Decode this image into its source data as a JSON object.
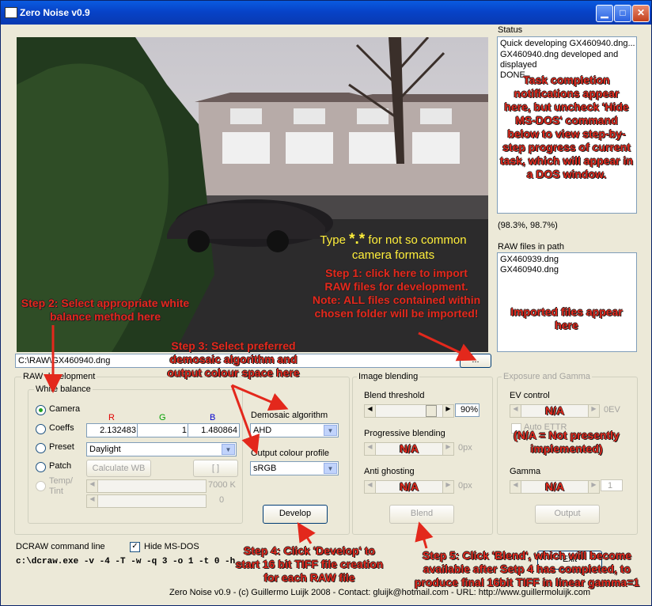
{
  "window": {
    "title": "Zero Noise v0.9"
  },
  "status": {
    "label": "Status",
    "lines": [
      "Quick developing GX460940.dng...",
      "GX460940.dng developed and",
      "displayed",
      "DONE"
    ],
    "coords": "(98.3%, 98.7%)"
  },
  "raw_files": {
    "label": "RAW files in path",
    "items": [
      "GX460939.dng",
      "GX460940.dng"
    ]
  },
  "path_field": {
    "value": "C:\\RAW\\GX460940.dng",
    "browse_label": "..."
  },
  "raw_dev": {
    "title": "RAW development",
    "wb_title": "White balance",
    "camera": "Camera",
    "coeffs": "Coeffs",
    "preset": "Preset",
    "patch": "Patch",
    "temp": "Temp/",
    "tint": "Tint",
    "r": "R",
    "g": "G",
    "b": "B",
    "r_val": "2.132483",
    "g_val": "1",
    "b_val": "1.480864",
    "preset_val": "Daylight",
    "calc_wb": "Calculate WB",
    "patch_btn": "[   ]",
    "temp_val": "7000 K",
    "tint_val": "0",
    "demosaic_label": "Demosaic algorithm",
    "demosaic_val": "AHD",
    "profile_label": "Output colour profile",
    "profile_val": "sRGB",
    "develop": "Develop"
  },
  "blending": {
    "title": "Image blending",
    "threshold_label": "Blend threshold",
    "threshold_val": "90%",
    "threshold_fraction": 0.9,
    "progressive_label": "Progressive blending",
    "progressive_val": "0px",
    "anti_label": "Anti ghosting",
    "anti_val": "0px",
    "blend_btn": "Blend"
  },
  "exposure": {
    "title": "Exposure and Gamma",
    "ev_label": "EV control",
    "ev_val": "0EV",
    "auto_ettr": "Auto ETTR",
    "gamma_label": "Gamma",
    "gamma_val": "1",
    "output_btn": "Output"
  },
  "dcraw": {
    "label": "DCRAW command line",
    "hide_msdos": "Hide MS-DOS",
    "command": "c:\\dcraw.exe -v -4 -T -w -q 3 -o 1 -t 0 -h"
  },
  "footer": "Zero Noise v0.9 - (c) Guillermo Luijk 2008 - Contact: gluijk@hotmail.com - URL: http://www.guillermoluijk.com",
  "exit_label": "Exit",
  "annotations": {
    "status_note": "Task completion notifications appear here, but uncheck 'Hide MS-DOS' command below to view step-by-step progress of current task, which will appear in a DOS window.",
    "type_hint_1": "Type",
    "type_hint_star": "*.*",
    "type_hint_2": "for not so common camera formats",
    "step1": "Step 1: click here to import RAW files for development. Note: ALL files contained within chosen folder will be imported!",
    "imported": "Imported files appear here",
    "step2": "Step 2: Select appropriate white balance method here",
    "step3": "Step 3: Select preferred demosaic algorithm and output colour space here",
    "na": "N/A",
    "na_note": "(N/A = Not presently implemented)",
    "step4": "Step 4: Click 'Develop' to start 16 bit TIFF file creation for each RAW file",
    "step5": "Step 5: Click 'Blend', which will become available after Setp 4 has completed, to produce final 16bit TIFF in linear gamma=1"
  },
  "colors": {
    "accent": "#e3281c",
    "hint": "#ffef3a",
    "titlebar": "#0743c8"
  }
}
